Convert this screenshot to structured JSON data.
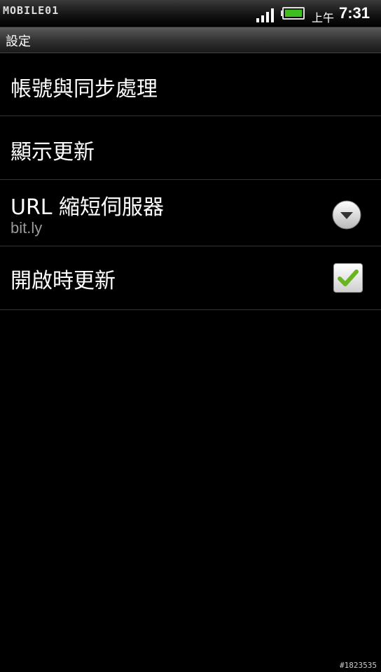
{
  "status_bar": {
    "carrier_logo": "MOBILE01",
    "ampm": "上午",
    "time": "7:31",
    "signal_icon": "signal-icon",
    "battery_icon": "battery-icon",
    "battery_color": "#3fbf1f"
  },
  "title_bar": {
    "title": "設定"
  },
  "settings": {
    "items": [
      {
        "label": "帳號與同步處理"
      },
      {
        "label": "顯示更新"
      },
      {
        "label": "URL 縮短伺服器",
        "summary": "bit.ly",
        "control": "dropdown"
      },
      {
        "label": "開啟時更新",
        "control": "checkbox",
        "checked": true
      }
    ]
  },
  "watermark": {
    "id": "#1823535"
  },
  "colors": {
    "background": "#000000",
    "summary_text": "#9a9a9a",
    "check_green": "#6ab51e"
  }
}
